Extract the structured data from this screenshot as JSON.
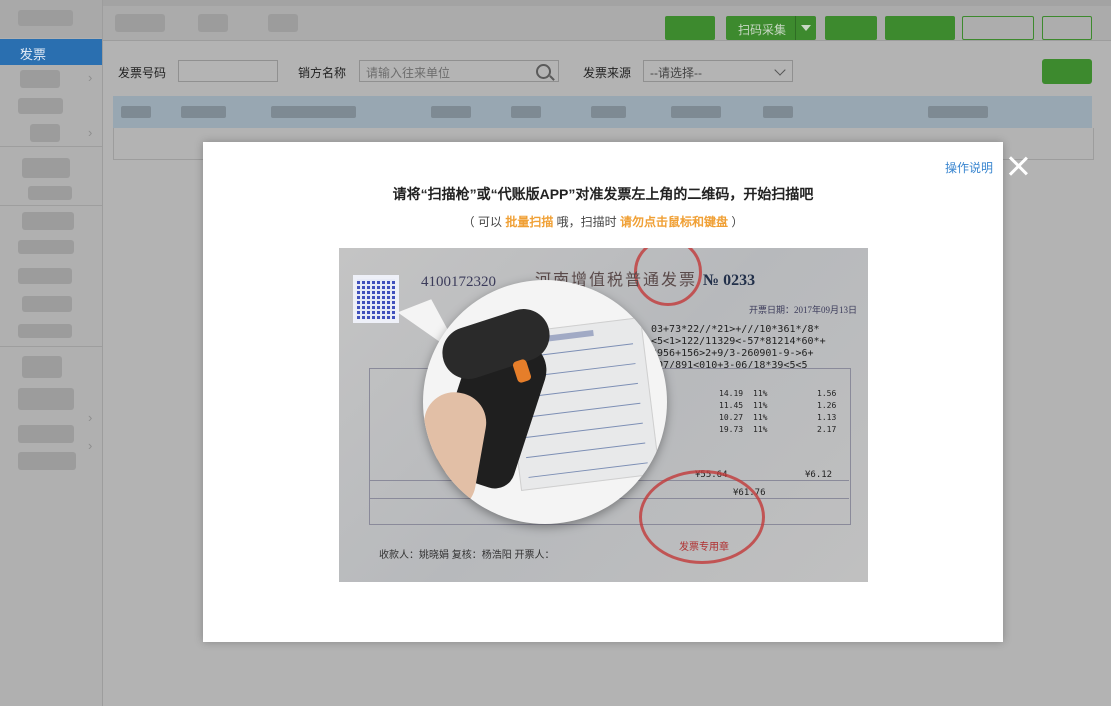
{
  "sidebar": {
    "active_item": {
      "label": "发票",
      "chevron": "›"
    },
    "chevrons": [
      "›",
      "›",
      "›",
      "›"
    ]
  },
  "toolbar": {
    "scan_collect_label": "扫码采集"
  },
  "filters": {
    "invoice_no_label": "发票号码",
    "invoice_no_value": "",
    "seller_label": "销方名称",
    "seller_placeholder": "请输入往来单位",
    "source_label": "发票来源",
    "source_selected": "--请选择--"
  },
  "modal": {
    "help_link": "操作说明",
    "title": "请将“扫描枪”或“代账版APP”对准发票左上角的二维码，开始扫描吧",
    "sub_prefix": "（ 可以 ",
    "sub_highlight_1": "批量扫描",
    "sub_middle": " 哦，扫描时 ",
    "sub_highlight_2": "请勿点击鼠标和键盘",
    "sub_suffix": " ）"
  },
  "illustration": {
    "invoice_code": "4100172320",
    "invoice_title": "河南增值税普通发票",
    "invoice_number": "№ 0233",
    "invoice_date": "开票日期：2017年09月13日",
    "cipher_lines": [
      "03+73*22//*21>+///10*361*/8*",
      "<5<1>122/11329<-57*81214*60*+",
      "3956+156>2+9/3-260901-9->6+",
      "807/891<010+3-06/18*39<5<5"
    ],
    "amounts": [
      "14.19",
      "11.45",
      "10.27",
      "19.73"
    ],
    "rates": [
      "11%",
      "11%",
      "11%",
      "11%"
    ],
    "taxes": [
      "1.56",
      "1.26",
      "1.13",
      "2.17"
    ],
    "total_amount": "¥55.64",
    "total_tax": "¥6.12",
    "grand_total": "¥61.76",
    "stamp_text": "发票专用章",
    "footer": "收款人：姚晓娟      复核：杨浩阳      开票人：",
    "colors": {
      "qr": "#2e3fb6",
      "stamp": "#c23a3a",
      "scanner_accent": "#e67e2a"
    }
  },
  "colors": {
    "accent_green": "#3d8a2e",
    "active_blue": "#2a6fb0",
    "link_blue": "#3a86d0",
    "highlight_orange": "#f0a035"
  }
}
